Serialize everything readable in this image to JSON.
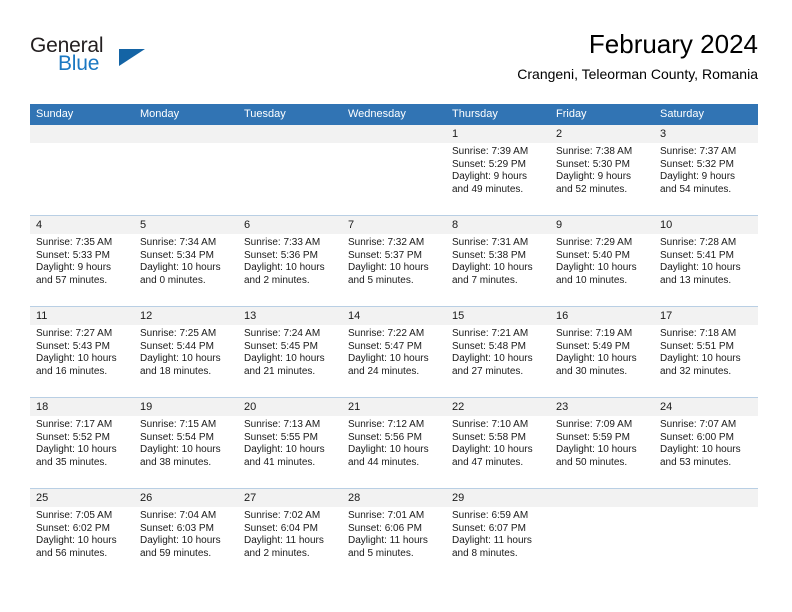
{
  "brand": {
    "name_part1": "General",
    "name_part2": "Blue",
    "triangle_color": "#1464a5"
  },
  "header": {
    "title": "February 2024",
    "subtitle": "Crangeni, Teleorman County, Romania",
    "header_bg_color": "#3174b4",
    "daynum_band_color": "#f2f2f2",
    "grid_line_color": "#b9cfe4"
  },
  "weekdays": [
    "Sunday",
    "Monday",
    "Tuesday",
    "Wednesday",
    "Thursday",
    "Friday",
    "Saturday"
  ],
  "weeks": [
    [
      {
        "day": "",
        "sunrise": "",
        "sunset": "",
        "daylight1": "",
        "daylight2": ""
      },
      {
        "day": "",
        "sunrise": "",
        "sunset": "",
        "daylight1": "",
        "daylight2": ""
      },
      {
        "day": "",
        "sunrise": "",
        "sunset": "",
        "daylight1": "",
        "daylight2": ""
      },
      {
        "day": "",
        "sunrise": "",
        "sunset": "",
        "daylight1": "",
        "daylight2": ""
      },
      {
        "day": "1",
        "sunrise": "Sunrise: 7:39 AM",
        "sunset": "Sunset: 5:29 PM",
        "daylight1": "Daylight: 9 hours",
        "daylight2": "and 49 minutes."
      },
      {
        "day": "2",
        "sunrise": "Sunrise: 7:38 AM",
        "sunset": "Sunset: 5:30 PM",
        "daylight1": "Daylight: 9 hours",
        "daylight2": "and 52 minutes."
      },
      {
        "day": "3",
        "sunrise": "Sunrise: 7:37 AM",
        "sunset": "Sunset: 5:32 PM",
        "daylight1": "Daylight: 9 hours",
        "daylight2": "and 54 minutes."
      }
    ],
    [
      {
        "day": "4",
        "sunrise": "Sunrise: 7:35 AM",
        "sunset": "Sunset: 5:33 PM",
        "daylight1": "Daylight: 9 hours",
        "daylight2": "and 57 minutes."
      },
      {
        "day": "5",
        "sunrise": "Sunrise: 7:34 AM",
        "sunset": "Sunset: 5:34 PM",
        "daylight1": "Daylight: 10 hours",
        "daylight2": "and 0 minutes."
      },
      {
        "day": "6",
        "sunrise": "Sunrise: 7:33 AM",
        "sunset": "Sunset: 5:36 PM",
        "daylight1": "Daylight: 10 hours",
        "daylight2": "and 2 minutes."
      },
      {
        "day": "7",
        "sunrise": "Sunrise: 7:32 AM",
        "sunset": "Sunset: 5:37 PM",
        "daylight1": "Daylight: 10 hours",
        "daylight2": "and 5 minutes."
      },
      {
        "day": "8",
        "sunrise": "Sunrise: 7:31 AM",
        "sunset": "Sunset: 5:38 PM",
        "daylight1": "Daylight: 10 hours",
        "daylight2": "and 7 minutes."
      },
      {
        "day": "9",
        "sunrise": "Sunrise: 7:29 AM",
        "sunset": "Sunset: 5:40 PM",
        "daylight1": "Daylight: 10 hours",
        "daylight2": "and 10 minutes."
      },
      {
        "day": "10",
        "sunrise": "Sunrise: 7:28 AM",
        "sunset": "Sunset: 5:41 PM",
        "daylight1": "Daylight: 10 hours",
        "daylight2": "and 13 minutes."
      }
    ],
    [
      {
        "day": "11",
        "sunrise": "Sunrise: 7:27 AM",
        "sunset": "Sunset: 5:43 PM",
        "daylight1": "Daylight: 10 hours",
        "daylight2": "and 16 minutes."
      },
      {
        "day": "12",
        "sunrise": "Sunrise: 7:25 AM",
        "sunset": "Sunset: 5:44 PM",
        "daylight1": "Daylight: 10 hours",
        "daylight2": "and 18 minutes."
      },
      {
        "day": "13",
        "sunrise": "Sunrise: 7:24 AM",
        "sunset": "Sunset: 5:45 PM",
        "daylight1": "Daylight: 10 hours",
        "daylight2": "and 21 minutes."
      },
      {
        "day": "14",
        "sunrise": "Sunrise: 7:22 AM",
        "sunset": "Sunset: 5:47 PM",
        "daylight1": "Daylight: 10 hours",
        "daylight2": "and 24 minutes."
      },
      {
        "day": "15",
        "sunrise": "Sunrise: 7:21 AM",
        "sunset": "Sunset: 5:48 PM",
        "daylight1": "Daylight: 10 hours",
        "daylight2": "and 27 minutes."
      },
      {
        "day": "16",
        "sunrise": "Sunrise: 7:19 AM",
        "sunset": "Sunset: 5:49 PM",
        "daylight1": "Daylight: 10 hours",
        "daylight2": "and 30 minutes."
      },
      {
        "day": "17",
        "sunrise": "Sunrise: 7:18 AM",
        "sunset": "Sunset: 5:51 PM",
        "daylight1": "Daylight: 10 hours",
        "daylight2": "and 32 minutes."
      }
    ],
    [
      {
        "day": "18",
        "sunrise": "Sunrise: 7:17 AM",
        "sunset": "Sunset: 5:52 PM",
        "daylight1": "Daylight: 10 hours",
        "daylight2": "and 35 minutes."
      },
      {
        "day": "19",
        "sunrise": "Sunrise: 7:15 AM",
        "sunset": "Sunset: 5:54 PM",
        "daylight1": "Daylight: 10 hours",
        "daylight2": "and 38 minutes."
      },
      {
        "day": "20",
        "sunrise": "Sunrise: 7:13 AM",
        "sunset": "Sunset: 5:55 PM",
        "daylight1": "Daylight: 10 hours",
        "daylight2": "and 41 minutes."
      },
      {
        "day": "21",
        "sunrise": "Sunrise: 7:12 AM",
        "sunset": "Sunset: 5:56 PM",
        "daylight1": "Daylight: 10 hours",
        "daylight2": "and 44 minutes."
      },
      {
        "day": "22",
        "sunrise": "Sunrise: 7:10 AM",
        "sunset": "Sunset: 5:58 PM",
        "daylight1": "Daylight: 10 hours",
        "daylight2": "and 47 minutes."
      },
      {
        "day": "23",
        "sunrise": "Sunrise: 7:09 AM",
        "sunset": "Sunset: 5:59 PM",
        "daylight1": "Daylight: 10 hours",
        "daylight2": "and 50 minutes."
      },
      {
        "day": "24",
        "sunrise": "Sunrise: 7:07 AM",
        "sunset": "Sunset: 6:00 PM",
        "daylight1": "Daylight: 10 hours",
        "daylight2": "and 53 minutes."
      }
    ],
    [
      {
        "day": "25",
        "sunrise": "Sunrise: 7:05 AM",
        "sunset": "Sunset: 6:02 PM",
        "daylight1": "Daylight: 10 hours",
        "daylight2": "and 56 minutes."
      },
      {
        "day": "26",
        "sunrise": "Sunrise: 7:04 AM",
        "sunset": "Sunset: 6:03 PM",
        "daylight1": "Daylight: 10 hours",
        "daylight2": "and 59 minutes."
      },
      {
        "day": "27",
        "sunrise": "Sunrise: 7:02 AM",
        "sunset": "Sunset: 6:04 PM",
        "daylight1": "Daylight: 11 hours",
        "daylight2": "and 2 minutes."
      },
      {
        "day": "28",
        "sunrise": "Sunrise: 7:01 AM",
        "sunset": "Sunset: 6:06 PM",
        "daylight1": "Daylight: 11 hours",
        "daylight2": "and 5 minutes."
      },
      {
        "day": "29",
        "sunrise": "Sunrise: 6:59 AM",
        "sunset": "Sunset: 6:07 PM",
        "daylight1": "Daylight: 11 hours",
        "daylight2": "and 8 minutes."
      },
      {
        "day": "",
        "sunrise": "",
        "sunset": "",
        "daylight1": "",
        "daylight2": ""
      },
      {
        "day": "",
        "sunrise": "",
        "sunset": "",
        "daylight1": "",
        "daylight2": ""
      }
    ]
  ]
}
